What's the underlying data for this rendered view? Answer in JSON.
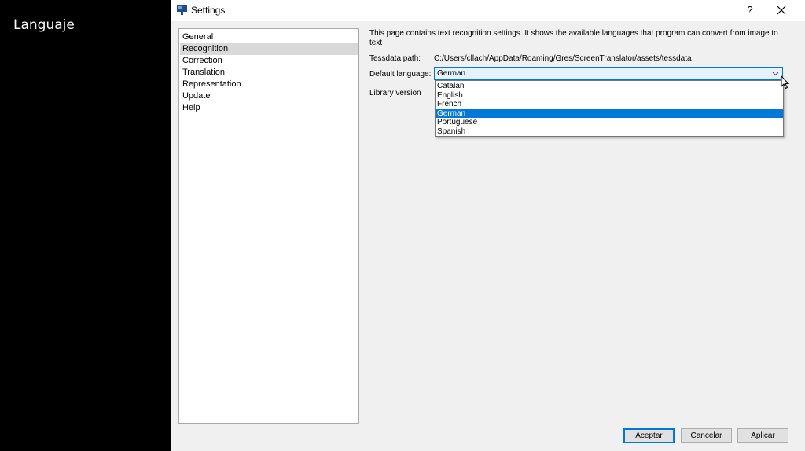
{
  "caption": "Languaje",
  "window": {
    "title": "Settings",
    "help_label": "?",
    "close_label": "✕"
  },
  "nav": {
    "items": [
      {
        "label": "General"
      },
      {
        "label": "Recognition",
        "selected": true
      },
      {
        "label": "Correction"
      },
      {
        "label": "Translation"
      },
      {
        "label": "Representation"
      },
      {
        "label": "Update"
      },
      {
        "label": "Help"
      }
    ]
  },
  "recognition": {
    "description": "This page contains text recognition settings. It shows the available languages that program can convert from image to text",
    "tessdata_label": "Tessdata path:",
    "tessdata_value": "C:/Users/cllach/AppData/Roaming/Gres/ScreenTranslator/assets/tessdata",
    "default_language_label": "Default language:",
    "default_language_value": "German",
    "library_version_label": "Library version",
    "language_options": [
      "Catalan",
      "English",
      "French",
      "German",
      "Portuguese",
      "Spanish"
    ],
    "highlighted_option": "German"
  },
  "buttons": {
    "ok": "Aceptar",
    "cancel": "Cancelar",
    "apply": "Aplicar"
  },
  "colors": {
    "accent": "#0078d7",
    "nav_selected": "#d9d9d9"
  }
}
